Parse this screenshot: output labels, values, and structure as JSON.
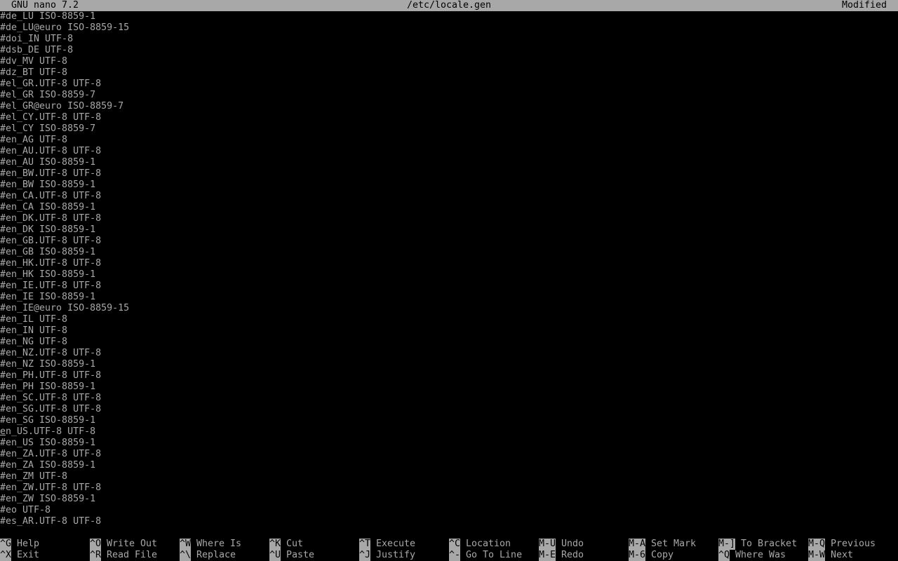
{
  "titlebar": {
    "app": "GNU nano 7.2",
    "file": "/etc/locale.gen",
    "state": "Modified"
  },
  "lines": [
    "#de_LU ISO-8859-1",
    "#de_LU@euro ISO-8859-15",
    "#doi_IN UTF-8",
    "#dsb_DE UTF-8",
    "#dv_MV UTF-8",
    "#dz_BT UTF-8",
    "#el_GR.UTF-8 UTF-8",
    "#el_GR ISO-8859-7",
    "#el_GR@euro ISO-8859-7",
    "#el_CY.UTF-8 UTF-8",
    "#el_CY ISO-8859-7",
    "#en_AG UTF-8",
    "#en_AU.UTF-8 UTF-8",
    "#en_AU ISO-8859-1",
    "#en_BW.UTF-8 UTF-8",
    "#en_BW ISO-8859-1",
    "#en_CA.UTF-8 UTF-8",
    "#en_CA ISO-8859-1",
    "#en_DK.UTF-8 UTF-8",
    "#en_DK ISO-8859-1",
    "#en_GB.UTF-8 UTF-8",
    "#en_GB ISO-8859-1",
    "#en_HK.UTF-8 UTF-8",
    "#en_HK ISO-8859-1",
    "#en_IE.UTF-8 UTF-8",
    "#en_IE ISO-8859-1",
    "#en_IE@euro ISO-8859-15",
    "#en_IL UTF-8",
    "#en_IN UTF-8",
    "#en_NG UTF-8",
    "#en_NZ.UTF-8 UTF-8",
    "#en_NZ ISO-8859-1",
    "#en_PH.UTF-8 UTF-8",
    "#en_PH ISO-8859-1",
    "#en_SC.UTF-8 UTF-8",
    "#en_SG.UTF-8 UTF-8",
    "#en_SG ISO-8859-1",
    "en_US.UTF-8 UTF-8",
    "#en_US ISO-8859-1",
    "#en_ZA.UTF-8 UTF-8",
    "#en_ZA ISO-8859-1",
    "#en_ZM UTF-8",
    "#en_ZW.UTF-8 UTF-8",
    "#en_ZW ISO-8859-1",
    "#eo UTF-8",
    "#es_AR.UTF-8 UTF-8"
  ],
  "cursor_line_index": 37,
  "shortcuts": {
    "row1": [
      {
        "key": "^G",
        "label": "Help"
      },
      {
        "key": "^O",
        "label": "Write Out"
      },
      {
        "key": "^W",
        "label": "Where Is"
      },
      {
        "key": "^K",
        "label": "Cut"
      },
      {
        "key": "^T",
        "label": "Execute"
      },
      {
        "key": "^C",
        "label": "Location"
      },
      {
        "key": "M-U",
        "label": "Undo"
      },
      {
        "key": "M-A",
        "label": "Set Mark"
      },
      {
        "key": "M-]",
        "label": "To Bracket"
      },
      {
        "key": "M-Q",
        "label": "Previous"
      }
    ],
    "row2": [
      {
        "key": "^X",
        "label": "Exit"
      },
      {
        "key": "^R",
        "label": "Read File"
      },
      {
        "key": "^\\",
        "label": "Replace"
      },
      {
        "key": "^U",
        "label": "Paste"
      },
      {
        "key": "^J",
        "label": "Justify"
      },
      {
        "key": "^-",
        "label": "Go To Line"
      },
      {
        "key": "M-E",
        "label": "Redo"
      },
      {
        "key": "M-6",
        "label": "Copy"
      },
      {
        "key": "^Q",
        "label": "Where Was"
      },
      {
        "key": "M-W",
        "label": "Next"
      }
    ]
  },
  "colors": {
    "background": "#000000",
    "foreground": "#a8a8a8",
    "inverse_bg": "#a8a8a8",
    "inverse_fg": "#000000"
  }
}
